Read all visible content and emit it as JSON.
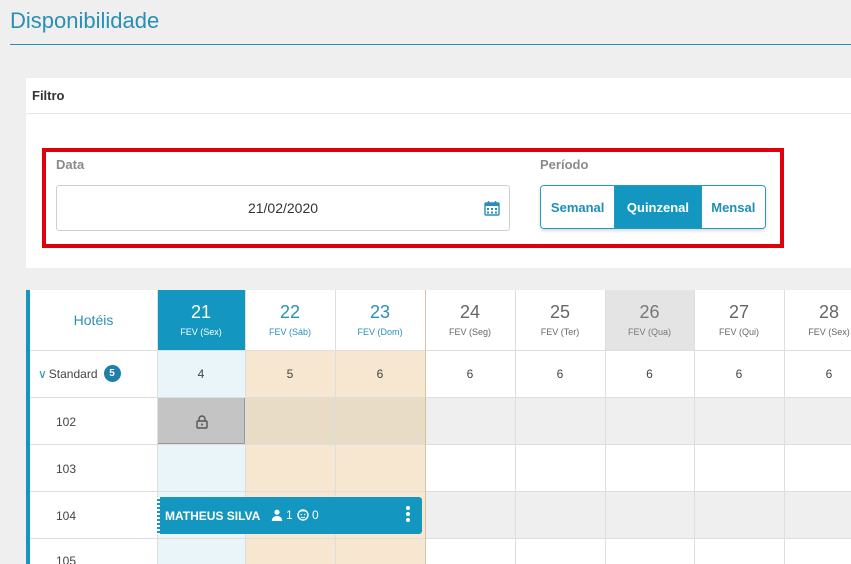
{
  "page": {
    "title": "Disponibilidade"
  },
  "filter": {
    "title": "Filtro",
    "date_label": "Data",
    "date_value": "21/02/2020",
    "period_label": "Período",
    "period_options": [
      "Semanal",
      "Quinzenal",
      "Mensal"
    ],
    "period_selected": "Quinzenal"
  },
  "grid": {
    "hotels_label": "Hotéis",
    "days": [
      {
        "num": "21",
        "sub": "FEV (Sex)",
        "state": "today"
      },
      {
        "num": "22",
        "sub": "FEV (Sáb)",
        "state": "weekend"
      },
      {
        "num": "23",
        "sub": "FEV (Dom)",
        "state": "weekend"
      },
      {
        "num": "24",
        "sub": "FEV (Seg)",
        "state": "normal"
      },
      {
        "num": "25",
        "sub": "FEV (Ter)",
        "state": "normal"
      },
      {
        "num": "26",
        "sub": "FEV (Qua)",
        "state": "grey"
      },
      {
        "num": "27",
        "sub": "FEV (Qui)",
        "state": "normal"
      },
      {
        "num": "28",
        "sub": "FEV (Sex)",
        "state": "normal"
      }
    ],
    "category": {
      "name": "Standard",
      "count": "5",
      "availability": [
        "4",
        "5",
        "6",
        "6",
        "6",
        "6",
        "6",
        "6"
      ]
    },
    "rooms": [
      "102",
      "103",
      "104",
      "105"
    ],
    "booking": {
      "guest": "MATHEUS SILVA",
      "adults": "1",
      "children": "0"
    }
  },
  "colors": {
    "accent": "#1396bf",
    "today_bg": "#e9f5f8",
    "weekend_bg": "#f7e6d0",
    "highlight_border": "#e0000b"
  }
}
